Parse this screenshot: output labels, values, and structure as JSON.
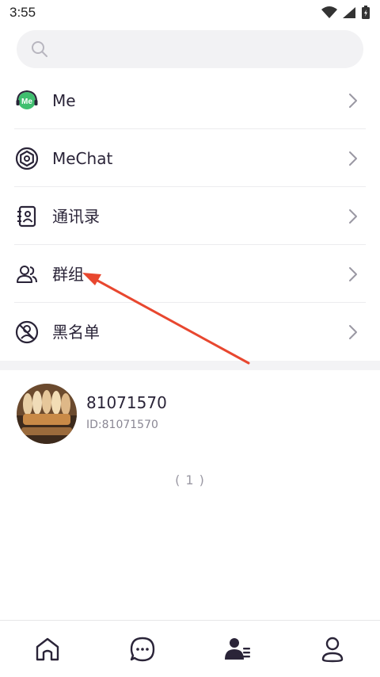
{
  "status_bar": {
    "time": "3:55"
  },
  "search": {
    "placeholder": ""
  },
  "menu": {
    "items": [
      {
        "label": "Me",
        "icon": "me-badge-icon"
      },
      {
        "label": "MeChat",
        "icon": "mechat-hex-icon"
      },
      {
        "label": "通讯录",
        "icon": "contacts-book-icon"
      },
      {
        "label": "群组",
        "icon": "group-users-icon"
      },
      {
        "label": "黑名单",
        "icon": "blocked-user-icon"
      }
    ]
  },
  "group": {
    "name": "81071570",
    "id_text": "ID:81071570"
  },
  "list_count": "( 1 )",
  "tabbar": {
    "tabs": [
      "home-icon",
      "chat-icon",
      "contacts-icon",
      "profile-icon"
    ],
    "active": "contacts-icon"
  },
  "colors": {
    "accent_green": "#3fbf6f",
    "icon_dark": "#2a2438",
    "arrow_red": "#e8472f"
  }
}
